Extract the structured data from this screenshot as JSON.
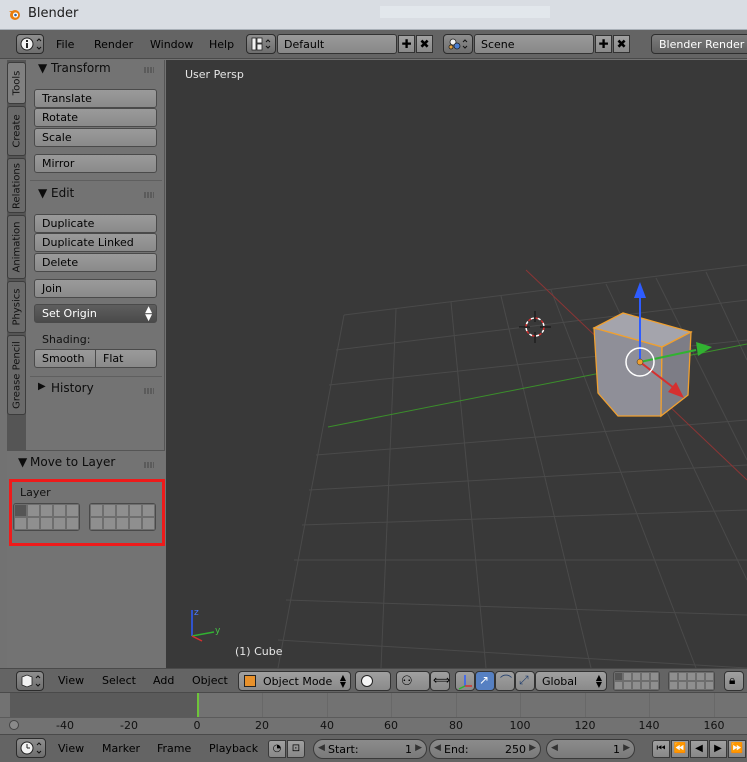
{
  "window": {
    "title": "Blender"
  },
  "info_header": {
    "menus": [
      "File",
      "Render",
      "Window",
      "Help"
    ],
    "screen_layout": "Default",
    "scene": "Scene",
    "render_engine": "Blender Render"
  },
  "tool_tabs": [
    "Tools",
    "Create",
    "Relations",
    "Animation",
    "Physics",
    "Grease Pencil"
  ],
  "tool_shelf": {
    "transform": {
      "title": "Transform",
      "buttons": [
        "Translate",
        "Rotate",
        "Scale",
        "Mirror"
      ]
    },
    "edit": {
      "title": "Edit",
      "buttons": [
        "Duplicate",
        "Duplicate Linked",
        "Delete",
        "Join"
      ],
      "set_origin": "Set Origin",
      "shading_label": "Shading:",
      "smooth": "Smooth",
      "flat": "Flat"
    },
    "history": {
      "title": "History"
    }
  },
  "move_to_layer": {
    "title": "Move to Layer",
    "layer_label": "Layer"
  },
  "viewport": {
    "view_name": "User Persp",
    "object_info": "(1) Cube"
  },
  "view3d_header": {
    "menus": [
      "View",
      "Select",
      "Add",
      "Object"
    ],
    "mode": "Object Mode",
    "orientation": "Global"
  },
  "timeline": {
    "ticks": [
      "-40",
      "-20",
      "0",
      "20",
      "40",
      "60",
      "80",
      "100",
      "120",
      "140",
      "160"
    ],
    "current_frame": 1
  },
  "timeline_header": {
    "menus": [
      "View",
      "Marker",
      "Frame",
      "Playback"
    ],
    "start_label": "Start:",
    "start_value": "1",
    "end_label": "End:",
    "end_value": "250",
    "current_value": "1"
  },
  "colors": {
    "highlight_red": "#ee1b1b",
    "selection_orange": "#f0a030",
    "x_axis": "#d53030",
    "y_axis": "#31b231",
    "z_axis": "#2e5cff"
  }
}
